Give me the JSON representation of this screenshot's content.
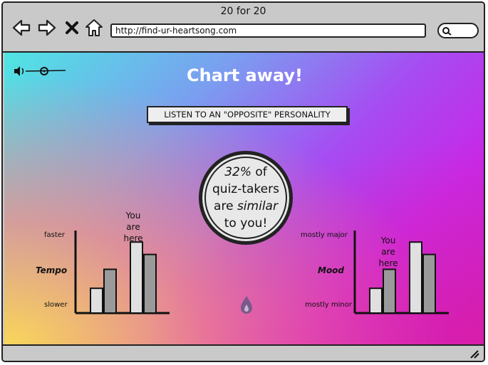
{
  "window": {
    "title": "20 for 20",
    "url": "http://find-ur-heartsong.com"
  },
  "icons": {
    "back": "back-arrow-icon",
    "forward": "forward-arrow-icon",
    "stop": "close-icon",
    "home": "home-icon",
    "search": "search-icon",
    "volume": "volume-icon",
    "drop": "drop-icon",
    "resize": "resize-grip-icon"
  },
  "main": {
    "headline": "Chart away!",
    "opposite_button": "LISTEN TO AN \"OPPOSITE\" PERSONALITY",
    "stat": {
      "percent": "32%",
      "line1_rest": " of",
      "line2": "quiz-takers",
      "line3_pre": "are ",
      "line3_em": "similar",
      "line4": "to you!"
    }
  },
  "tempo_chart": {
    "axis_name": "Tempo",
    "top_label": "faster",
    "bottom_label": "slower",
    "marker_line1": "You",
    "marker_line2": "are",
    "marker_line3": "here"
  },
  "mood_chart": {
    "axis_name": "Mood",
    "top_label": "mostly major",
    "bottom_label": "mostly minor",
    "marker_line1": "You",
    "marker_line2": "are",
    "marker_line3": "here"
  },
  "chart_data": [
    {
      "type": "bar",
      "ylabel": "Tempo",
      "values": [
        3,
        5.3,
        8.6,
        7.1
      ],
      "bar_colors": [
        "#e0e0e0",
        "#9a9a9a",
        "#e0e0e0",
        "#9a9a9a"
      ],
      "highlight_index": 2
    },
    {
      "type": "bar",
      "ylabel": "Mood",
      "values": [
        3,
        5.3,
        8.6,
        7.1
      ],
      "bar_colors": [
        "#e0e0e0",
        "#9a9a9a",
        "#e0e0e0",
        "#9a9a9a"
      ],
      "highlight_index": 2
    }
  ]
}
